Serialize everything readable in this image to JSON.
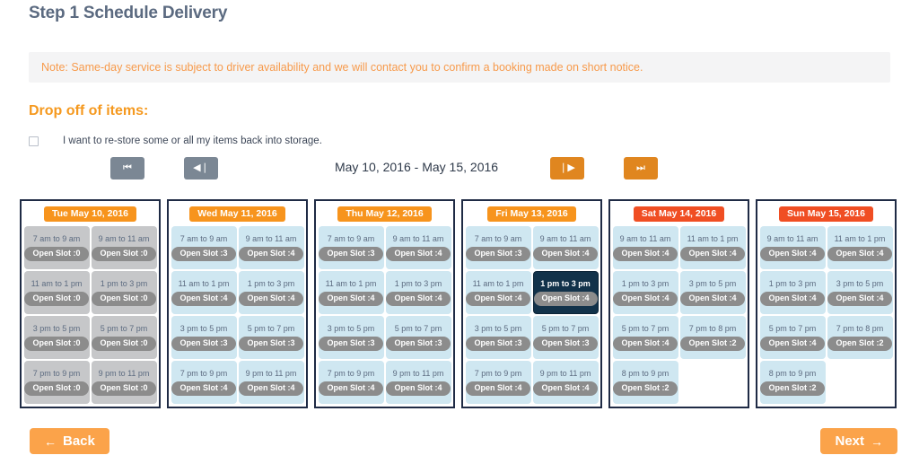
{
  "page": {
    "title": "Step 1 Schedule Delivery",
    "note": "Note: Same-day service is subject to driver availability and we will contact you to confirm a booking made on short notice.",
    "section_heading": "Drop off of items:",
    "restore_checkbox_label": "I want to re-store some or all my items back into storage.",
    "date_range": "May 10, 2016 - May 15, 2016"
  },
  "nav": {
    "first_label": "⏮",
    "prev_label": "◀❘",
    "next_label": "❘▶",
    "last_label": "⏭"
  },
  "footer": {
    "back_label": "Back",
    "back_arrow": "←",
    "next_label": "Next",
    "next_arrow": "→"
  },
  "colors": {
    "weekday_badge": "#f7941d",
    "weekend_badge": "#f04e23",
    "slot_available": "#cfe7f1",
    "slot_disabled": "#c6c7c9",
    "slot_selected": "#12324a",
    "pill": "#8c8c8c",
    "accent_orange": "#fba34a",
    "title_slate": "#5b6a80"
  },
  "days": [
    {
      "label": "Tue May 10, 2016",
      "kind": "weekday",
      "slots": [
        {
          "time": "7 am to 9 am",
          "open": "Open Slot :0",
          "state": "disabled"
        },
        {
          "time": "9 am to 11 am",
          "open": "Open Slot :0",
          "state": "disabled"
        },
        {
          "time": "11 am to 1 pm",
          "open": "Open Slot :0",
          "state": "disabled"
        },
        {
          "time": "1 pm to 3 pm",
          "open": "Open Slot :0",
          "state": "disabled"
        },
        {
          "time": "3 pm to 5 pm",
          "open": "Open Slot :0",
          "state": "disabled"
        },
        {
          "time": "5 pm to 7 pm",
          "open": "Open Slot :0",
          "state": "disabled"
        },
        {
          "time": "7 pm to 9 pm",
          "open": "Open Slot :0",
          "state": "disabled"
        },
        {
          "time": "9 pm to 11 pm",
          "open": "Open Slot :0",
          "state": "disabled"
        }
      ]
    },
    {
      "label": "Wed May 11, 2016",
      "kind": "weekday",
      "slots": [
        {
          "time": "7 am to 9 am",
          "open": "Open Slot :3",
          "state": "available"
        },
        {
          "time": "9 am to 11 am",
          "open": "Open Slot :4",
          "state": "available"
        },
        {
          "time": "11 am to 1 pm",
          "open": "Open Slot :4",
          "state": "available"
        },
        {
          "time": "1 pm to 3 pm",
          "open": "Open Slot :4",
          "state": "available"
        },
        {
          "time": "3 pm to 5 pm",
          "open": "Open Slot :3",
          "state": "available"
        },
        {
          "time": "5 pm to 7 pm",
          "open": "Open Slot :3",
          "state": "available"
        },
        {
          "time": "7 pm to 9 pm",
          "open": "Open Slot :4",
          "state": "available"
        },
        {
          "time": "9 pm to 11 pm",
          "open": "Open Slot :4",
          "state": "available"
        }
      ]
    },
    {
      "label": "Thu May 12, 2016",
      "kind": "weekday",
      "slots": [
        {
          "time": "7 am to 9 am",
          "open": "Open Slot :3",
          "state": "available"
        },
        {
          "time": "9 am to 11 am",
          "open": "Open Slot :4",
          "state": "available"
        },
        {
          "time": "11 am to 1 pm",
          "open": "Open Slot :4",
          "state": "available"
        },
        {
          "time": "1 pm to 3 pm",
          "open": "Open Slot :4",
          "state": "available"
        },
        {
          "time": "3 pm to 5 pm",
          "open": "Open Slot :3",
          "state": "available"
        },
        {
          "time": "5 pm to 7 pm",
          "open": "Open Slot :3",
          "state": "available"
        },
        {
          "time": "7 pm to 9 pm",
          "open": "Open Slot :4",
          "state": "available"
        },
        {
          "time": "9 pm to 11 pm",
          "open": "Open Slot :4",
          "state": "available"
        }
      ]
    },
    {
      "label": "Fri May 13, 2016",
      "kind": "weekday",
      "slots": [
        {
          "time": "7 am to 9 am",
          "open": "Open Slot :3",
          "state": "available"
        },
        {
          "time": "9 am to 11 am",
          "open": "Open Slot :4",
          "state": "available"
        },
        {
          "time": "11 am to 1 pm",
          "open": "Open Slot :4",
          "state": "available"
        },
        {
          "time": "1 pm to 3 pm",
          "open": "Open Slot :4",
          "state": "selected"
        },
        {
          "time": "3 pm to 5 pm",
          "open": "Open Slot :3",
          "state": "available"
        },
        {
          "time": "5 pm to 7 pm",
          "open": "Open Slot :3",
          "state": "available"
        },
        {
          "time": "7 pm to 9 pm",
          "open": "Open Slot :4",
          "state": "available"
        },
        {
          "time": "9 pm to 11 pm",
          "open": "Open Slot :4",
          "state": "available"
        }
      ]
    },
    {
      "label": "Sat May 14, 2016",
      "kind": "weekend",
      "slots": [
        {
          "time": "9 am to 11 am",
          "open": "Open Slot :4",
          "state": "available"
        },
        {
          "time": "11 am to 1 pm",
          "open": "Open Slot :4",
          "state": "available"
        },
        {
          "time": "1 pm to 3 pm",
          "open": "Open Slot :4",
          "state": "available"
        },
        {
          "time": "3 pm to 5 pm",
          "open": "Open Slot :4",
          "state": "available"
        },
        {
          "time": "5 pm to 7 pm",
          "open": "Open Slot :4",
          "state": "available"
        },
        {
          "time": "7 pm to 8 pm",
          "open": "Open Slot :2",
          "state": "available"
        },
        {
          "time": "8 pm to 9 pm",
          "open": "Open Slot :2",
          "state": "available"
        }
      ]
    },
    {
      "label": "Sun May 15, 2016",
      "kind": "weekend",
      "slots": [
        {
          "time": "9 am to 11 am",
          "open": "Open Slot :4",
          "state": "available"
        },
        {
          "time": "11 am to 1 pm",
          "open": "Open Slot :4",
          "state": "available"
        },
        {
          "time": "1 pm to 3 pm",
          "open": "Open Slot :4",
          "state": "available"
        },
        {
          "time": "3 pm to 5 pm",
          "open": "Open Slot :4",
          "state": "available"
        },
        {
          "time": "5 pm to 7 pm",
          "open": "Open Slot :4",
          "state": "available"
        },
        {
          "time": "7 pm to 8 pm",
          "open": "Open Slot :2",
          "state": "available"
        },
        {
          "time": "8 pm to 9 pm",
          "open": "Open Slot :2",
          "state": "available"
        }
      ]
    }
  ]
}
